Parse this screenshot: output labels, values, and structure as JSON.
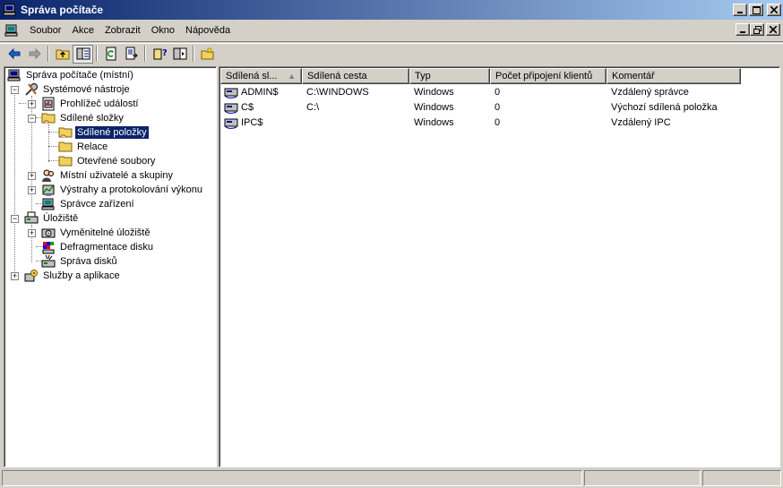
{
  "window": {
    "title": "Správa počítače"
  },
  "menu": [
    {
      "label": "Soubor"
    },
    {
      "label": "Akce"
    },
    {
      "label": "Zobrazit"
    },
    {
      "label": "Okno"
    },
    {
      "label": "Nápověda"
    }
  ],
  "tree": {
    "root": "Správa počítače (místní)",
    "system_tools": "Systémové nástroje",
    "event_viewer": "Prohlížeč událostí",
    "shared_folders": "Sdílené složky",
    "shares": "Sdílené položky",
    "sessions": "Relace",
    "open_files": "Otevřené soubory",
    "local_users": "Místní uživatelé a skupiny",
    "perf_logs": "Výstrahy a protokolování výkonu",
    "device_manager": "Správce zařízení",
    "storage": "Úložiště",
    "removable_storage": "Vyměnitelné úložiště",
    "defrag": "Defragmentace disku",
    "disk_mgmt": "Správa disků",
    "services_apps": "Služby a aplikace"
  },
  "list": {
    "columns": [
      "Sdílená sl...",
      "Sdílená cesta",
      "Typ",
      "Počet připojení klientů",
      "Komentář"
    ],
    "rows": [
      {
        "name": "ADMIN$",
        "path": "C:\\WINDOWS",
        "type": "Windows",
        "clients": "0",
        "comment": "Vzdálený správce"
      },
      {
        "name": "C$",
        "path": "C:\\",
        "type": "Windows",
        "clients": "0",
        "comment": "Výchozí sdílená položka"
      },
      {
        "name": "IPC$",
        "path": "",
        "type": "Windows",
        "clients": "0",
        "comment": "Vzdálený IPC"
      }
    ]
  }
}
